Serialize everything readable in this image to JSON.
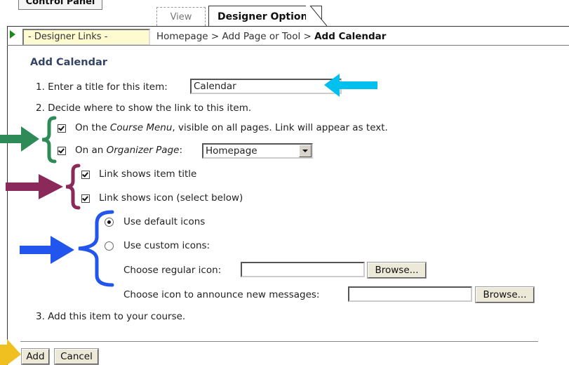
{
  "header": {
    "control_panel": "Control Panel",
    "tabs": [
      {
        "label": "View"
      },
      {
        "label": "Designer Options"
      }
    ]
  },
  "nav": {
    "designer_links": "- Designer Links -",
    "breadcrumb_path": "Homepage > Add Page or Tool > ",
    "breadcrumb_current": "Add Calendar"
  },
  "form": {
    "title": "Add Calendar",
    "step1_label": "1.  Enter a title for this item:",
    "step1_value": "Calendar",
    "step2_label": "2.  Decide where to show the link to this item.",
    "course_menu": {
      "prefix": "On the ",
      "italic": "Course Menu",
      "suffix": ", visible on all pages. Link will appear as text.",
      "checked": true
    },
    "organizer": {
      "prefix": "On an ",
      "italic": "Organizer Page",
      "suffix": ":",
      "checked": true,
      "selected": "Homepage"
    },
    "link_title": {
      "label": "Link shows item title",
      "checked": true
    },
    "link_icon": {
      "label": "Link shows icon (select below)",
      "checked": true
    },
    "default_icons": {
      "label": "Use default icons",
      "selected": true
    },
    "custom_icons": {
      "label": "Use custom icons:",
      "selected": false
    },
    "regular_icon": {
      "label": "Choose regular icon:",
      "value": "",
      "browse": "Browse..."
    },
    "new_msg_icon": {
      "label": "Choose icon to announce new messages:",
      "value": "",
      "browse": "Browse..."
    },
    "step3_label": "3.  Add this item to your course."
  },
  "actions": {
    "add": "Add",
    "cancel": "Cancel"
  },
  "annotation_colors": {
    "cyan": "#00c0f0",
    "green": "#2e8b57",
    "maroon": "#8b2a5a",
    "blue": "#2255ee",
    "yellow": "#f0c020"
  }
}
